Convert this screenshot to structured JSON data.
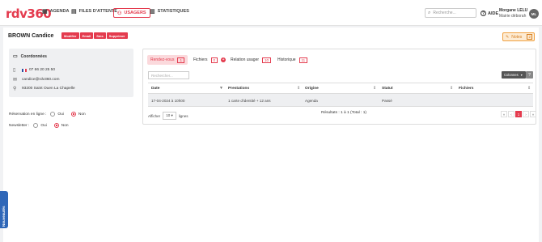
{
  "header": {
    "logo": "rdv360",
    "nav": [
      {
        "label": "AGENDA",
        "icon": "calendar-icon"
      },
      {
        "label": "FILES D'ATTENTE",
        "icon": "queue-icon"
      },
      {
        "label": "USAGERS",
        "icon": "users-icon"
      },
      {
        "label": "STATISTIQUES",
        "icon": "stats-icon"
      }
    ],
    "search_placeholder": "Recherche...",
    "help_label": "AIDE",
    "user_name": "Morgane LELU",
    "user_sub": "Mairie déborah",
    "avatar_initials": "ML"
  },
  "client": {
    "name": "BROWN Candice",
    "actions": [
      "Modifier",
      "Email",
      "Sms",
      "Supprimer"
    ],
    "notes_label": "Notes",
    "notes_count": "2"
  },
  "coordonnees": {
    "title": "Coordonnées",
    "phone": "07 66 20 25 50",
    "email": "candice@rdv360.com",
    "address": "93200 Saint Ouen La Chapelle"
  },
  "options": {
    "reservation_label": "Réservation en ligne :",
    "newsletter_label": "Newsletter :",
    "oui": "Oui",
    "non": "Non"
  },
  "tabs": [
    {
      "label": "Rendez-vous",
      "count": "1"
    },
    {
      "label": "Fichiers",
      "count": "0"
    },
    {
      "label": "Relation usager",
      "count": "10"
    },
    {
      "label": "Historique",
      "count": "11"
    }
  ],
  "table": {
    "search_placeholder": "Rechercher...",
    "columns_button": "Colonnes",
    "help": "?",
    "headers": [
      "Date",
      "Prestations",
      "Origine",
      "Statut",
      "Fichiers"
    ],
    "rows": [
      [
        "17-04-2024 à 10h00",
        "1 carte d'identité + 12 ans",
        "Agenda",
        "Passé",
        ""
      ]
    ],
    "show_label": "Afficher",
    "show_value": "10",
    "lines_label": "lignes",
    "results": "Résultats : 1 à 1 (Total : 1)",
    "pager": [
      "«",
      "‹",
      "1",
      "›",
      "»"
    ]
  },
  "side_tab": "Nouveautés"
}
